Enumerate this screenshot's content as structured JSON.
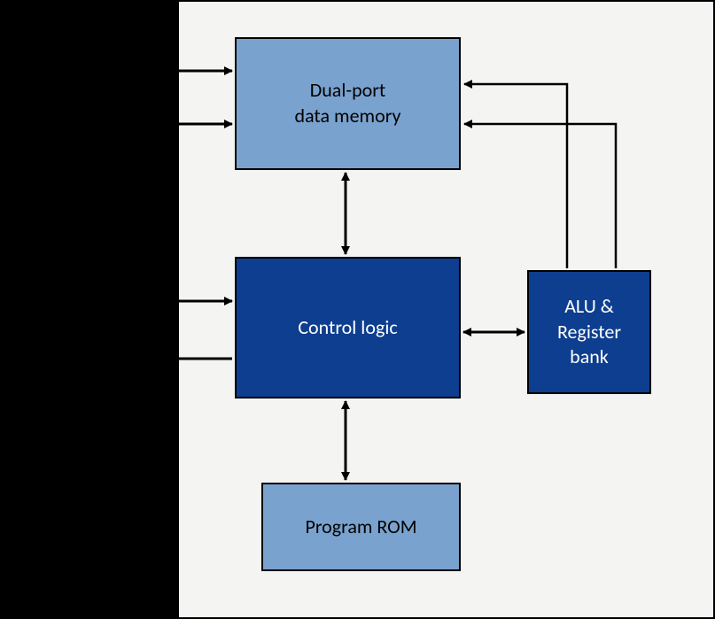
{
  "blocks": {
    "data_memory": "Dual-port\ndata memory",
    "control_logic": "Control logic",
    "alu_register": "ALU &\nRegister\nbank",
    "program_rom": "Program ROM"
  },
  "colors": {
    "light_block": "#7aa2ce",
    "dark_block": "#0d3e8f",
    "frame_bg": "#f4f4f3"
  },
  "diagram": {
    "type": "block_diagram",
    "description": "Processor architecture block diagram",
    "connections": [
      {
        "from": "external",
        "to": "data_memory",
        "direction": "bidirectional",
        "count": 2
      },
      {
        "from": "external",
        "to": "control_logic",
        "direction": "in"
      },
      {
        "from": "control_logic",
        "to": "external",
        "direction": "out"
      },
      {
        "from": "data_memory",
        "to": "control_logic",
        "direction": "bidirectional"
      },
      {
        "from": "control_logic",
        "to": "program_rom",
        "direction": "bidirectional"
      },
      {
        "from": "control_logic",
        "to": "alu_register",
        "direction": "bidirectional"
      },
      {
        "from": "alu_register",
        "to": "data_memory",
        "direction": "in",
        "count": 2
      }
    ]
  }
}
